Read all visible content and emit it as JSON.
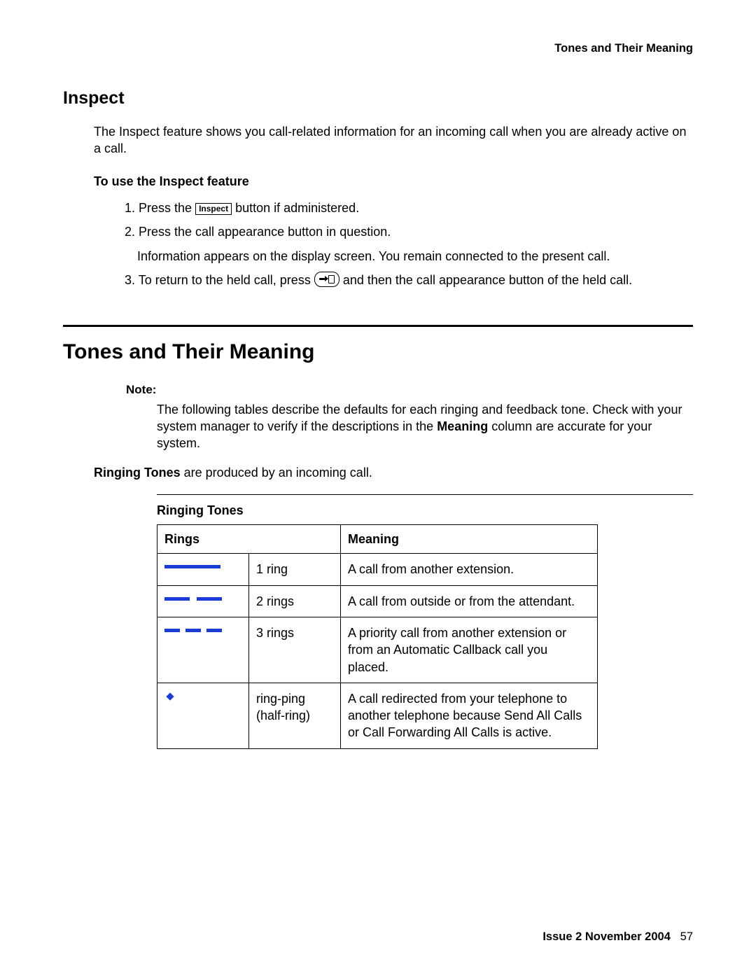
{
  "header": {
    "running": "Tones and Their Meaning"
  },
  "inspect": {
    "title": "Inspect",
    "paragraph": "The Inspect feature shows you call-related information for an incoming call when you are already active on a call.",
    "subhead": "To use the Inspect feature",
    "step1_a": "1. Press the ",
    "inspect_btn": "Inspect",
    "step1_b": " button if administered.",
    "step2": "2. Press the call appearance button in question.",
    "step2_note": "Information appears on the display screen. You remain connected to the present call.",
    "step3_a": "3. To return to the held call, press ",
    "step3_b": " and then the call appearance button of the held call."
  },
  "tones": {
    "title": "Tones and Their Meaning",
    "note_label": "Note:",
    "note_a": "The following tables describe the defaults for each ringing and feedback tone. Check with your system manager to verify if the descriptions in the ",
    "note_bold": "Meaning",
    "note_b": " column are accurate for your system.",
    "intro_bold": "Ringing Tones",
    "intro_rest": " are produced by an incoming call.",
    "table_title": "Ringing Tones",
    "col_rings": "Rings",
    "col_meaning": "Meaning",
    "rows": [
      {
        "rings": "1 ring",
        "meaning": "A call from another extension."
      },
      {
        "rings": "2 rings",
        "meaning": "A call from outside or from the attendant."
      },
      {
        "rings": "3 rings",
        "meaning": "A priority call from another extension or from an Automatic Callback call you placed."
      },
      {
        "rings": "ring-ping (half-ring)",
        "meaning": "A call redirected from your telephone to another telephone because Send All Calls or Call Forwarding All Calls is active."
      }
    ]
  },
  "footer": {
    "issue": "Issue 2   November 2004",
    "page": "57"
  }
}
